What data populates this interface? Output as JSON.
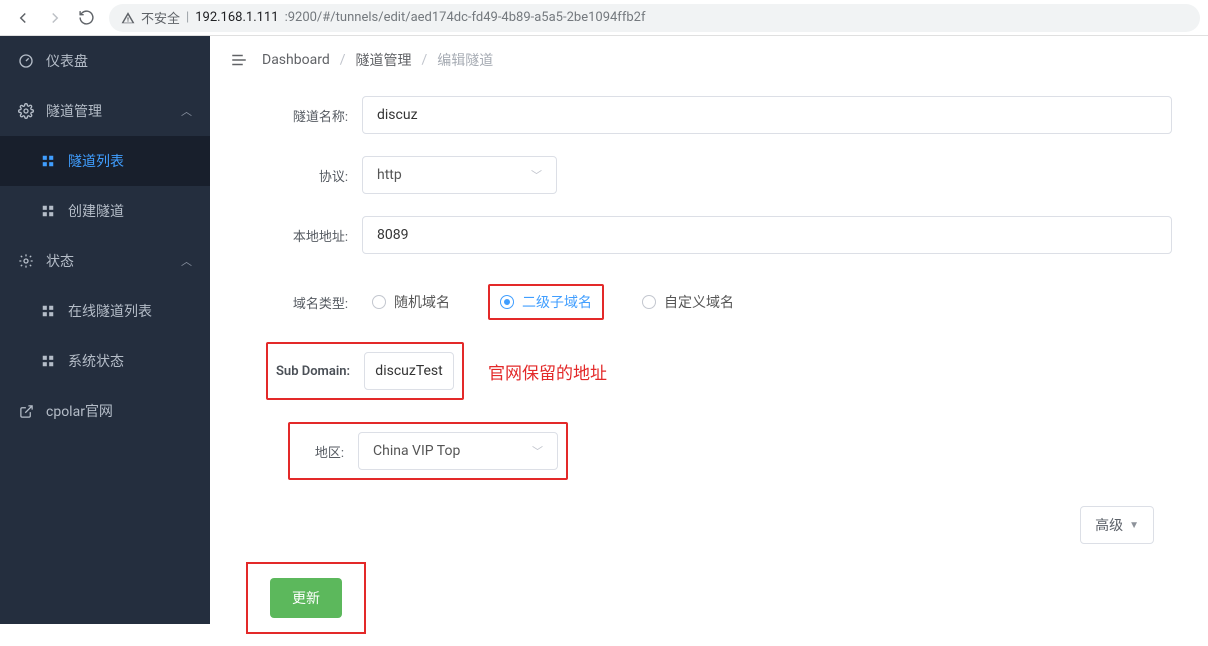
{
  "browser": {
    "insecure_label": "不安全",
    "url_host": "192.168.1.111",
    "url_port_path": ":9200/#/tunnels/edit/aed174dc-fd49-4b89-a5a5-2be1094ffb2f"
  },
  "sidebar": {
    "dashboard": "仪表盘",
    "tunnel_mgmt": "隧道管理",
    "tunnel_list": "隧道列表",
    "tunnel_create": "创建隧道",
    "status": "状态",
    "online_list": "在线隧道列表",
    "sys_status": "系统状态",
    "cpolar": "cpolar官网"
  },
  "breadcrumb": {
    "a": "Dashboard",
    "b": "隧道管理",
    "c": "编辑隧道"
  },
  "form": {
    "name_label": "隧道名称:",
    "name_value": "discuz",
    "proto_label": "协议:",
    "proto_value": "http",
    "local_label": "本地地址:",
    "local_value": "8089",
    "domain_type_label": "域名类型:",
    "domain_opts": {
      "random": "随机域名",
      "sub": "二级子域名",
      "custom": "自定义域名"
    },
    "subdomain_label": "Sub Domain:",
    "subdomain_value": "discuzTest",
    "annotation": "官网保留的地址",
    "region_label": "地区:",
    "region_value": "China VIP Top",
    "advanced": "高级",
    "submit": "更新"
  }
}
